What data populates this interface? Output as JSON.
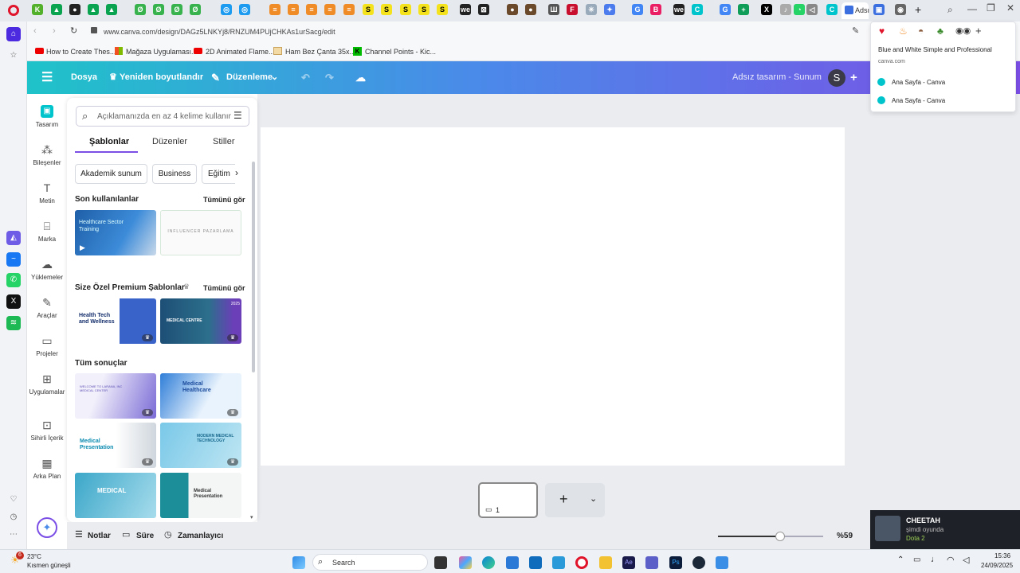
{
  "browser": {
    "address_url": "www.canva.com/design/DAGz5LNKYj8/RNZUM4PUjCHKAs1urSacg/edit",
    "active_tab_title": "Adsı",
    "bookmarks": [
      {
        "label": "How to Create Thes..."
      },
      {
        "label": "Mağaza Uygulaması..."
      },
      {
        "label": "2D Animated Flame..."
      },
      {
        "label": "Ham Bez Çanta 35x..."
      },
      {
        "label": "Channel Points - Kic..."
      }
    ]
  },
  "tab_popup": {
    "title": "Blue and White Simple and Professional",
    "domain": "canva.com",
    "items": [
      {
        "label": "Ana Sayfa - Canva"
      },
      {
        "label": "Ana Sayfa - Canva"
      }
    ]
  },
  "canva_header": {
    "file_label": "Dosya",
    "resize_label": "Yeniden boyutlandır",
    "edit_label": "Düzenleme",
    "doc_title": "Adsız tasarım - Sunum",
    "avatar_letter": "S"
  },
  "rail": {
    "items": [
      {
        "label": "Tasarım",
        "icon": "design-icon"
      },
      {
        "label": "Bileşenler",
        "icon": "elements-icon"
      },
      {
        "label": "Metin",
        "icon": "text-icon"
      },
      {
        "label": "Marka",
        "icon": "brand-icon"
      },
      {
        "label": "Yüklemeler",
        "icon": "upload-icon"
      },
      {
        "label": "Araçlar",
        "icon": "tools-icon"
      },
      {
        "label": "Projeler",
        "icon": "folder-icon"
      },
      {
        "label": "Uygulamalar",
        "icon": "apps-icon"
      },
      {
        "label": "Sihirli İçerik",
        "icon": "magic-media-icon"
      },
      {
        "label": "Arka Plan",
        "icon": "background-icon"
      }
    ]
  },
  "panel": {
    "search_placeholder": "Açıklamanızda en az 4 kelime kullanın",
    "tabs": [
      {
        "label": "Şablonlar",
        "active": true
      },
      {
        "label": "Düzenler",
        "active": false
      },
      {
        "label": "Stiller",
        "active": false
      }
    ],
    "chips": [
      {
        "label": "Akademik sunum"
      },
      {
        "label": "Business"
      },
      {
        "label": "Eğitim"
      }
    ],
    "recent": {
      "heading": "Son kullanılanlar",
      "see_all": "Tümünü gör",
      "thumb1_title": "Healthcare Sector Training",
      "thumb2_title": "INFLUENCER PAZARLAMA"
    },
    "premium": {
      "heading": "Size Özel Premium Şablonlar",
      "see_all": "Tümünü gör",
      "thumb1_title": "Health Tech and Wellness",
      "thumb2_title": "MEDICAL CENTRE",
      "thumb2_year": "2025"
    },
    "all_results": {
      "heading": "Tüm sonuçlar",
      "thumb1_title": "WELCOME TO LARANA, INC MEDICAL CENTER",
      "thumb2_title": "Medical Healthcare",
      "thumb3_title": "Medical Presentation",
      "thumb4_title": "MODERN MEDICAL TECHNOLOGY",
      "thumb5_title": "MEDICAL",
      "thumb6_title": "Medical Presentation"
    }
  },
  "bottom_bar": {
    "notes_label": "Notlar",
    "duration_label": "Süre",
    "timer_label": "Zamanlayıcı",
    "page_number": "1",
    "zoom_label": "%59",
    "zoom_fraction": 0.59
  },
  "notification": {
    "name": "CHEETAH",
    "status": "şimdi oyunda",
    "game": "Dota 2"
  },
  "taskbar": {
    "weather_temp": "23°C",
    "weather_desc": "Kısmen güneşli",
    "search_placeholder": "Search",
    "time": "15:36",
    "date": "24/09/2025",
    "badge_count": "6"
  },
  "colors": {
    "header_gradient_start": "#1fc3c9",
    "header_gradient_mid": "#4a8ae9",
    "header_gradient_end": "#7b4fe6",
    "opera_red": "#e0142b",
    "canva_teal": "#00c4cc"
  }
}
